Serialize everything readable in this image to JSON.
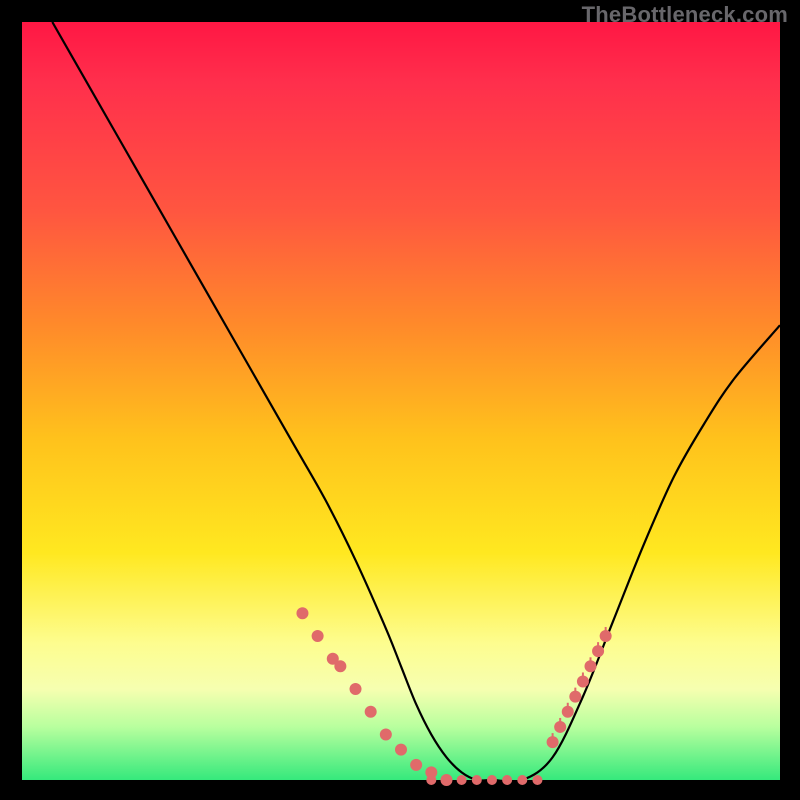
{
  "watermark": "TheBottleneck.com",
  "colors": {
    "background": "#000000",
    "gradient_top": "#ff1744",
    "gradient_mid": "#ffe820",
    "gradient_bottom": "#35e97c",
    "curve_stroke": "#000000",
    "marker_fill": "#e06a6a",
    "marker_tick": "#e06a6a"
  },
  "chart_data": {
    "type": "line",
    "title": "",
    "xlabel": "",
    "ylabel": "",
    "xlim": [
      0,
      100
    ],
    "ylim": [
      0,
      100
    ],
    "series": [
      {
        "name": "bottleneck-curve",
        "x": [
          4,
          8,
          12,
          16,
          20,
          24,
          28,
          32,
          36,
          40,
          44,
          48,
          50,
          52,
          54,
          56,
          58,
          60,
          62,
          66,
          70,
          74,
          78,
          82,
          86,
          90,
          94,
          100
        ],
        "y": [
          100,
          93,
          86,
          79,
          72,
          65,
          58,
          51,
          44,
          37,
          29,
          20,
          15,
          10,
          6,
          3,
          1,
          0,
          0,
          0,
          3,
          11,
          21,
          31,
          40,
          47,
          53,
          60
        ]
      }
    ],
    "markers_left": {
      "x": [
        37,
        39,
        41,
        42,
        44,
        46,
        48,
        50,
        52,
        54,
        56
      ],
      "y": [
        22,
        19,
        16,
        15,
        12,
        9,
        6,
        4,
        2,
        1,
        0
      ]
    },
    "markers_flat": {
      "x": [
        54,
        56,
        58,
        60,
        62,
        64,
        66,
        68
      ],
      "y": [
        0,
        0,
        0,
        0,
        0,
        0,
        0,
        0
      ]
    },
    "markers_right_dots": {
      "x": [
        70,
        71,
        72,
        73,
        74,
        75,
        76,
        77
      ],
      "y": [
        5,
        7,
        9,
        11,
        13,
        15,
        17,
        19
      ]
    },
    "markers_right_ticks": {
      "x": [
        70,
        71,
        72,
        73,
        74,
        75,
        76,
        77
      ],
      "y": [
        5,
        7,
        9,
        11,
        13,
        15,
        17,
        19
      ]
    }
  }
}
